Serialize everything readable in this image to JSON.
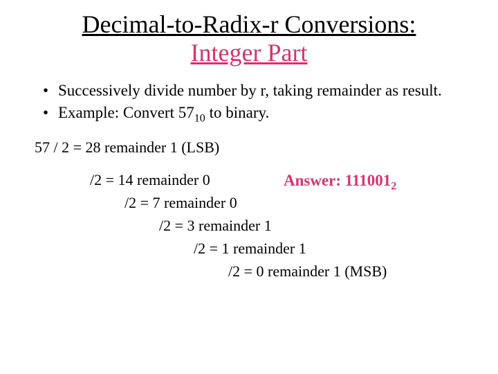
{
  "title": {
    "line1": "Decimal-to-Radix-r Conversions:",
    "line2": "Integer Part"
  },
  "bullets": {
    "b1": "Successively divide number by r, taking remainder as result.",
    "b2_pre": "Example: Convert 57",
    "b2_sub": "10",
    "b2_post": " to binary."
  },
  "steps": {
    "s0": "57 / 2 = 28 remainder 1 (LSB)",
    "s1": "/2 = 14 remainder 0",
    "s2": "/2 = 7 remainder 0",
    "s3": "/2 = 3 remainder 1",
    "s4": "/2 = 1 remainder 1",
    "s5": "/2 = 0 remainder 1 (MSB)"
  },
  "answer": {
    "label": "Answer: 111001",
    "sub": "2"
  }
}
